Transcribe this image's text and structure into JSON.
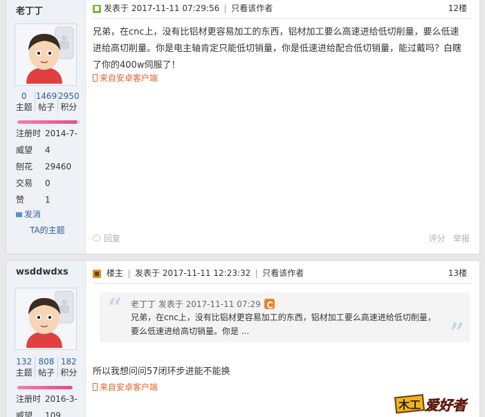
{
  "posts": [
    {
      "author": "老丁丁",
      "stats": [
        {
          "num": "0",
          "label": "主题"
        },
        {
          "num": "1469",
          "label": "帖子"
        },
        {
          "num": "2950",
          "label": "积分"
        }
      ],
      "info": [
        {
          "k": "注册时",
          "v": "2014-7-"
        },
        {
          "k": "威望",
          "v": "4"
        },
        {
          "k": "刨花",
          "v": "29460"
        },
        {
          "k": "交易",
          "v": "0"
        },
        {
          "k": "赞",
          "v": "1"
        }
      ],
      "pm_label": "发消",
      "ta_label": "TA的主题",
      "post_label": "发表于 2017-11-11 07:29:56",
      "only_author": "只看该作者",
      "floor": "12楼",
      "content": "兄弟，在cnc上，没有比铝材更容易加工的东西，铝材加工要么高速进给低切削量，要么低速进给高切削量。你是电主轴肯定只能低切销量，你是低速进给配合低切销量，能过戴吗？白瞎了你的400w伺服了！",
      "from_client": "来自安卓客户端",
      "reply": "回复",
      "rate": "评分",
      "report": "举报"
    },
    {
      "author": "wsddwdxs",
      "stats": [
        {
          "num": "132",
          "label": "主题"
        },
        {
          "num": "808",
          "label": "帖子"
        },
        {
          "num": "182",
          "label": "积分"
        }
      ],
      "info": [
        {
          "k": "注册时",
          "v": "2016-3-"
        },
        {
          "k": "威望",
          "v": "109"
        }
      ],
      "owner_label": "楼主",
      "post_label": "发表于 2017-11-11 12:23:32",
      "only_author": "只看该作者",
      "floor": "13楼",
      "quote_head": "老丁丁 发表于 2017-11-11 07:29",
      "quote_text": "兄弟，在cnc上，没有比铝材更容易加工的东西，铝材加工要么高速进给低切削量，要么低速进给高切销量。你是 ...",
      "content": "所以我想问问57闭环步进能不能换",
      "from_client": "来自安卓客户端"
    }
  ],
  "logo_text": "爱好者",
  "logo_mark": "木工",
  "colors": {
    "link": "#2a5f98",
    "client": "#e2602c",
    "accent": "#e04c8d"
  }
}
